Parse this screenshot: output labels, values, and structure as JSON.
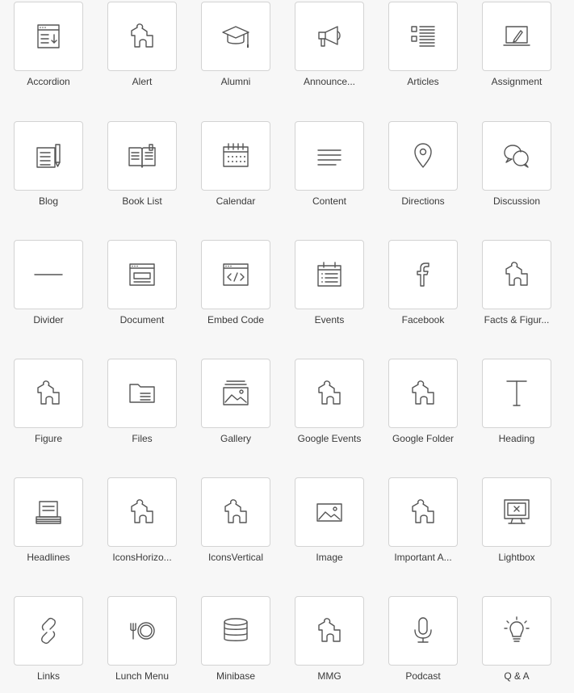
{
  "widgets": [
    {
      "label": "Accordion",
      "icon": "accordion-icon"
    },
    {
      "label": "Alert",
      "icon": "puzzle-icon"
    },
    {
      "label": "Alumni",
      "icon": "graduation-cap-icon"
    },
    {
      "label": "Announce...",
      "icon": "megaphone-icon"
    },
    {
      "label": "Articles",
      "icon": "list-icon"
    },
    {
      "label": "Assignment",
      "icon": "laptop-pencil-icon"
    },
    {
      "label": "Blog",
      "icon": "blog-icon"
    },
    {
      "label": "Book List",
      "icon": "book-icon"
    },
    {
      "label": "Calendar",
      "icon": "calendar-icon"
    },
    {
      "label": "Content",
      "icon": "text-lines-icon"
    },
    {
      "label": "Directions",
      "icon": "map-pin-icon"
    },
    {
      "label": "Discussion",
      "icon": "chat-bubbles-icon"
    },
    {
      "label": "Divider",
      "icon": "divider-line-icon"
    },
    {
      "label": "Document",
      "icon": "document-window-icon"
    },
    {
      "label": "Embed Code",
      "icon": "embed-code-icon"
    },
    {
      "label": "Events",
      "icon": "events-calendar-icon"
    },
    {
      "label": "Facebook",
      "icon": "facebook-icon"
    },
    {
      "label": "Facts & Figur...",
      "icon": "puzzle-icon"
    },
    {
      "label": "Figure",
      "icon": "puzzle-icon"
    },
    {
      "label": "Files",
      "icon": "folder-icon"
    },
    {
      "label": "Gallery",
      "icon": "gallery-icon"
    },
    {
      "label": "Google Events",
      "icon": "puzzle-icon"
    },
    {
      "label": "Google Folder",
      "icon": "puzzle-icon"
    },
    {
      "label": "Heading",
      "icon": "text-cursor-icon"
    },
    {
      "label": "Headlines",
      "icon": "headlines-icon"
    },
    {
      "label": "IconsHorizo...",
      "icon": "puzzle-icon"
    },
    {
      "label": "IconsVertical",
      "icon": "puzzle-icon"
    },
    {
      "label": "Image",
      "icon": "image-icon"
    },
    {
      "label": "Important A...",
      "icon": "puzzle-icon"
    },
    {
      "label": "Lightbox",
      "icon": "lightbox-icon"
    },
    {
      "label": "Links",
      "icon": "link-icon"
    },
    {
      "label": "Lunch Menu",
      "icon": "plate-fork-icon"
    },
    {
      "label": "Minibase",
      "icon": "database-icon"
    },
    {
      "label": "MMG",
      "icon": "puzzle-icon"
    },
    {
      "label": "Podcast",
      "icon": "microphone-icon"
    },
    {
      "label": "Q & A",
      "icon": "lightbulb-icon"
    }
  ]
}
